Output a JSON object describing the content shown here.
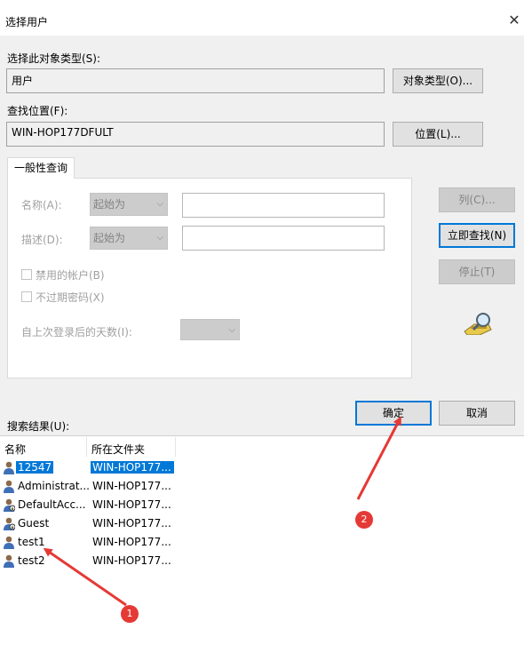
{
  "dialog": {
    "title": "选择用户",
    "close_glyph": "✕"
  },
  "object_type": {
    "label": "选择此对象类型(S):",
    "value": "用户",
    "button": "对象类型(O)..."
  },
  "location": {
    "label": "查找位置(F):",
    "value": "WIN-HOP177DFULT",
    "button": "位置(L)..."
  },
  "query": {
    "tab": "一般性查询",
    "name_label": "名称(A):",
    "name_mode": "起始为",
    "desc_label": "描述(D):",
    "desc_mode": "起始为",
    "disabled_accounts": "禁用的帐户(B)",
    "no_expire_password": "不过期密码(X)",
    "days_since_logon": "自上次登录后的天数(I):"
  },
  "side_buttons": {
    "columns": "列(C)...",
    "find_now": "立即查找(N)",
    "stop": "停止(T)"
  },
  "actions": {
    "ok": "确定",
    "cancel": "取消"
  },
  "results": {
    "label": "搜索结果(U):",
    "columns": [
      "名称",
      "所在文件夹"
    ],
    "rows": [
      {
        "name": "12547",
        "folder": "WIN-HOP177...",
        "selected": true
      },
      {
        "name": "Administrat...",
        "folder": "WIN-HOP177...",
        "selected": false
      },
      {
        "name": "DefaultAcc...",
        "folder": "WIN-HOP177...",
        "selected": false
      },
      {
        "name": "Guest",
        "folder": "WIN-HOP177...",
        "selected": false
      },
      {
        "name": "test1",
        "folder": "WIN-HOP177...",
        "selected": false
      },
      {
        "name": "test2",
        "folder": "WIN-HOP177...",
        "selected": false
      }
    ]
  },
  "annotations": {
    "marker_1": "1",
    "marker_2": "2",
    "color": "#e53935"
  },
  "colors": {
    "accent": "#0078d7",
    "dialog_bg": "#f0f0f0"
  }
}
